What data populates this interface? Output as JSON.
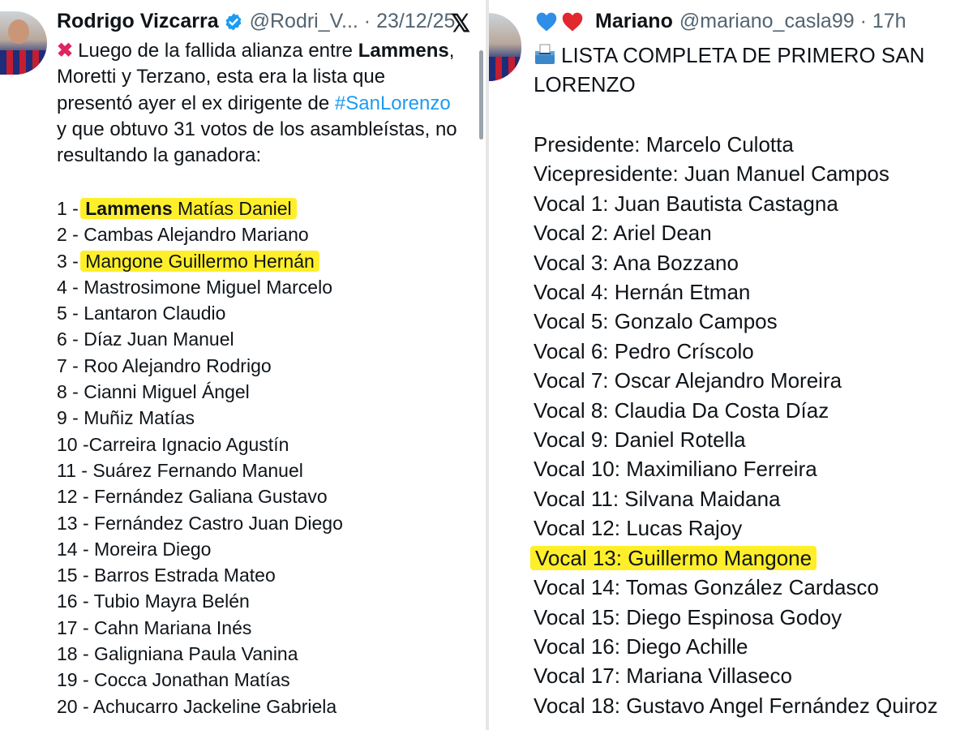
{
  "left_tweet": {
    "author_name": "Rodrigo Vizcarra",
    "handle_date": "@Rodri_V... · 23/12/25",
    "intro": {
      "l1_pre": "Luego de la fallida alianza entre ",
      "l1_bold": "Lammens",
      "l1_post": ",",
      "l2": "Moretti y Terzano, esta era la lista que",
      "l3_pre": "presentó ayer el ex dirigente de ",
      "l3_link": "#SanLorenzo",
      "l4": "y que obtuvo 31 votos de los asambleístas, no",
      "l5": "resultando la ganadora:"
    },
    "list": {
      "r1_num": "1 - ",
      "r1_bold": "Lammens",
      "r1_rest": " Matías Daniel",
      "r2": "2 - Cambas Alejandro Mariano",
      "r3_num": "3 - ",
      "r3_name": "Mangone Guillermo Hernán",
      "r4": "4 - Mastrosimone Miguel Marcelo",
      "r5": "5 - Lantaron Claudio",
      "r6": "6 - Díaz Juan Manuel",
      "r7": "7 - Roo Alejandro Rodrigo",
      "r8": "8 - Cianni Miguel Ángel",
      "r9": "9 - Muñiz Matías",
      "r10": "10 -Carreira Ignacio Agustín",
      "r11": "11 - Suárez Fernando Manuel",
      "r12": "12 - Fernández Galiana Gustavo",
      "r13": "13 - Fernández Castro Juan Diego",
      "r14": "14 - Moreira Diego",
      "r15": "15 - Barros Estrada Mateo",
      "r16": "16 - Tubio Mayra Belén",
      "r17": "17 - Cahn Mariana Inés",
      "r18": "18 - Galigniana Paula Vanina",
      "r19": "19 - Cocca Jonathan Matías",
      "r20": "20 - Achucarro Jackeline Gabriela"
    }
  },
  "right_tweet": {
    "author_name": "Mariano",
    "handle_time": "@mariano_casla99 · 17h",
    "title_l1": "LISTA COMPLETA DE PRIMERO SAN",
    "title_l2": "LORENZO",
    "list": [
      "Presidente: Marcelo Culotta",
      "Vicepresidente: Juan Manuel Campos",
      "Vocal 1: Juan Bautista Castagna",
      "Vocal 2: Ariel Dean",
      "Vocal 3: Ana Bozzano",
      "Vocal 4: Hernán Etman",
      "Vocal 5: Gonzalo Campos",
      "Vocal 6: Pedro Críscolo",
      "Vocal 7: Oscar Alejandro Moreira",
      "Vocal 8: Claudia Da Costa Díaz",
      "Vocal 9: Daniel Rotella",
      "Vocal 10: Maximiliano Ferreira",
      "Vocal 11: Silvana Maidana",
      "Vocal 12: Lucas Rajoy",
      "Vocal 13: Guillermo Mangone",
      "Vocal 14: Tomas González Cardasco",
      "Vocal 15: Diego Espinosa Godoy",
      "Vocal 16: Diego Achille",
      "Vocal 17: Mariana Villaseco",
      "Vocal 18: Gustavo Angel Fernández Quiroz"
    ]
  },
  "icons": {
    "verified": "verified-badge-icon",
    "x_logo": "x-logo-icon",
    "cross": "cross-mark-icon",
    "blue_heart": "blue-heart-icon",
    "red_heart": "red-heart-icon",
    "ballot": "ballot-box-icon"
  },
  "colors": {
    "highlight": "#ffef2a",
    "link": "#1d9bf0",
    "secondary_text": "#536471"
  }
}
